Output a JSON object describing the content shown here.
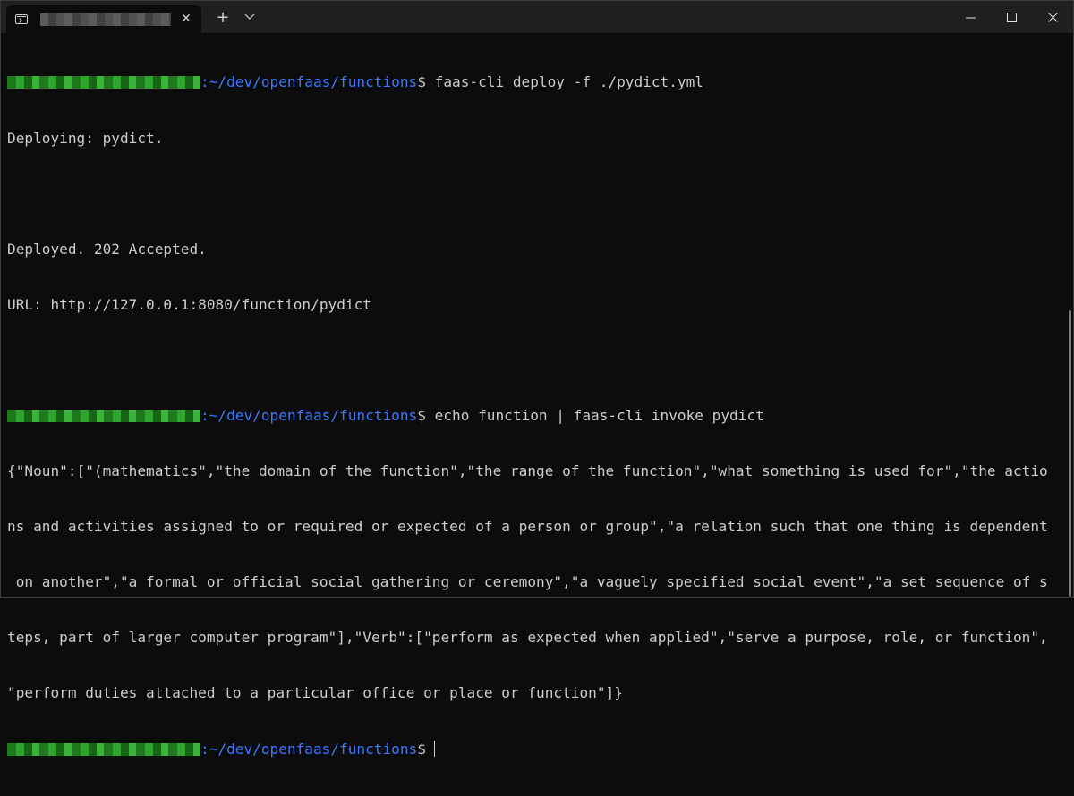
{
  "window": {
    "tab_close_glyph": "✕",
    "new_tab_glyph": "+",
    "icons": {
      "tab": "terminal-icon",
      "close": "close-icon",
      "new_tab": "plus-icon",
      "dropdown": "chevron-down-icon",
      "minimize": "minimize-icon",
      "maximize": "maximize-icon",
      "window_close": "close-icon"
    }
  },
  "terminal": {
    "prompt_path": ":~/dev/openfaas/functions",
    "prompt_symbol": "$",
    "cmd1": " faas-cli deploy -f ./pydict.yml",
    "out1": [
      "Deploying: pydict.",
      "",
      "Deployed. 202 Accepted.",
      "URL: http://127.0.0.1:8080/function/pydict",
      ""
    ],
    "cmd2": " echo function | faas-cli invoke pydict",
    "out2": [
      "{\"Noun\":[\"(mathematics\",\"the domain of the function\",\"the range of the function\",\"what something is used for\",\"the actio",
      "ns and activities assigned to or required or expected of a person or group\",\"a relation such that one thing is dependent",
      " on another\",\"a formal or official social gathering or ceremony\",\"a vaguely specified social event\",\"a set sequence of s",
      "teps, part of larger computer program\"],\"Verb\":[\"perform as expected when applied\",\"serve a purpose, role, or function\",",
      "\"perform duties attached to a particular office or place or function\"]}"
    ]
  },
  "colors": {
    "background": "#0c0c0c",
    "titlebar": "#1f1f1f",
    "text": "#cccccc",
    "path": "#3b78ff",
    "user_host": "#2fa52f"
  }
}
